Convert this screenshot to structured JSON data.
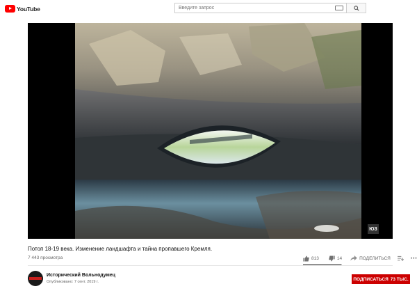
{
  "masthead": {
    "logo_text": "YouTube",
    "search_placeholder": "Введите запрос",
    "icons": [
      "youtube-logo",
      "keyboard-icon",
      "search-icon"
    ]
  },
  "player": {
    "watermark": "ЮЗ"
  },
  "video": {
    "title": "Потоп 18-19 века. Изменение ландшафта и тайна пропавшего Кремля.",
    "views": "7 443 просмотра",
    "likes": "813",
    "dislikes": "14",
    "share_label": "ПОДЕЛИТЬСЯ",
    "more_label": "•••",
    "like_ratio": 0.983
  },
  "channel": {
    "name": "Исторический Вольнодумец",
    "published": "Опубликовано: 7 сент. 2019 г.",
    "subscribe_label": "ПОДПИСАТЬСЯ",
    "subscribers": "73 ТЫС."
  },
  "colors": {
    "brand_red": "#ff0000",
    "subscribe_red": "#cc0000"
  }
}
